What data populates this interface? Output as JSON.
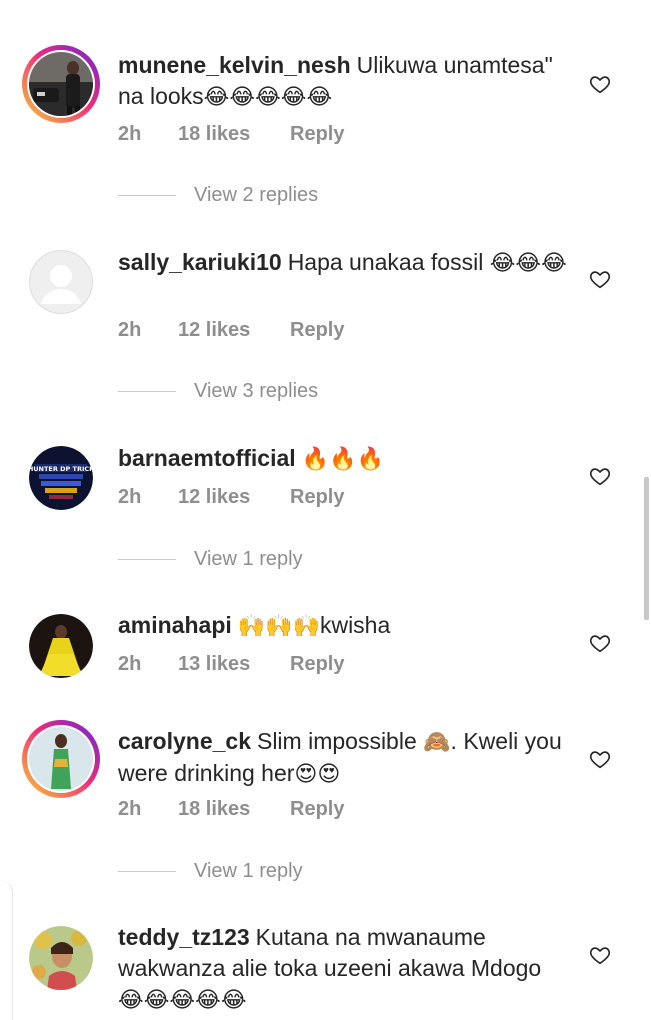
{
  "comments": [
    {
      "username": "munene_kelvin_nesh",
      "text": "Ulikuwa unamtesa\" na looks",
      "emoji": "😂😂😂😂😂",
      "time": "2h",
      "likes": "18 likes",
      "reply": "Reply",
      "view_replies": "View 2 replies",
      "avatar": "person-car-photo"
    },
    {
      "username": "sally_kariuki10",
      "text": "Hapa unakaa fossil ",
      "emoji": "😂😂😂",
      "time": "2h",
      "likes": "12 likes",
      "reply": "Reply",
      "view_replies": "View 3 replies",
      "avatar": "default-avatar"
    },
    {
      "username": "barnaemtofficial",
      "text": "",
      "emoji": "🔥🔥🔥",
      "time": "2h",
      "likes": "12 likes",
      "reply": "Reply",
      "view_replies": "View 1 reply",
      "avatar": "hunter-dp-trick-logo"
    },
    {
      "username": "aminahapi",
      "text": "",
      "emoji": "🙌🙌🙌",
      "text_after": "kwisha",
      "time": "2h",
      "likes": "13 likes",
      "reply": "Reply",
      "view_replies": "",
      "avatar": "woman-yellow-dress"
    },
    {
      "username": "carolyne_ck",
      "text": "Slim impossible ",
      "emoji": "🙈",
      "text_after": ". Kweli you were drinking her",
      "emoji_after": "😍😍",
      "time": "2h",
      "likes": "18 likes",
      "reply": "Reply",
      "view_replies": "View 1 reply",
      "avatar": "woman-green-outfit"
    },
    {
      "username": "teddy_tz123",
      "text": "Kutana na mwanaume wakwanza alie toka uzeeni akawa Mdogo ",
      "emoji": "😂😂😂😂😂",
      "avatar": "woman-floral-photo"
    }
  ],
  "colors": {
    "text": "#262626",
    "meta": "#8e8e8e",
    "ring_start": "#f9ce34",
    "ring_mid": "#ee2a7b",
    "ring_end": "#6228d7"
  },
  "icons": {
    "like": "heart-outline-icon"
  },
  "avatar_labels": {
    "hunter": "HUNTER DP TRICK"
  }
}
